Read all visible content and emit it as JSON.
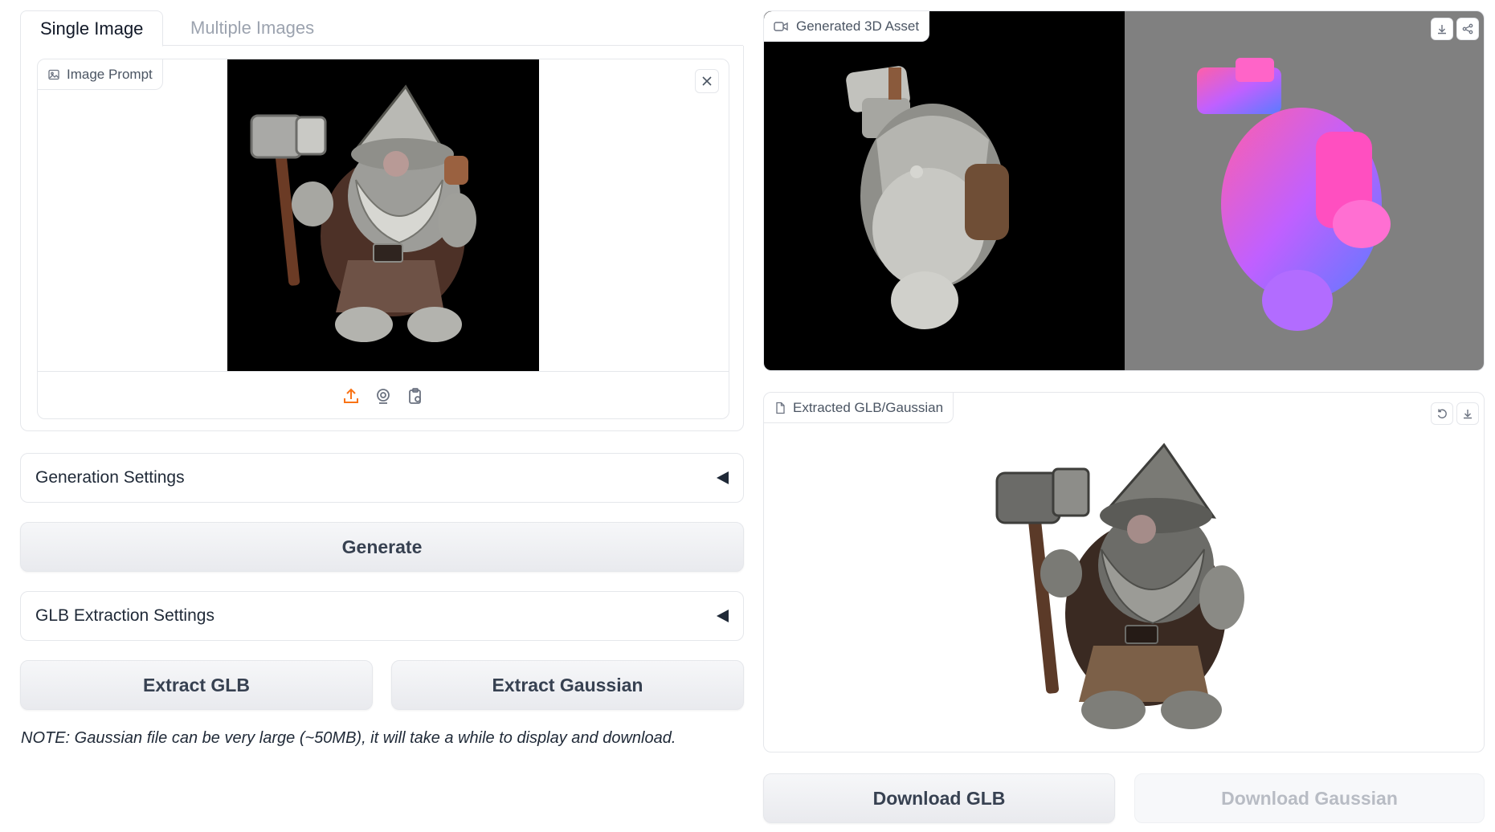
{
  "tabs": [
    {
      "label": "Single Image",
      "active": true
    },
    {
      "label": "Multiple Images",
      "active": false
    }
  ],
  "image_prompt": {
    "label": "Image Prompt",
    "image_description_icon": "image-icon",
    "source_icons": [
      "upload-icon",
      "webcam-icon",
      "clipboard-icon"
    ]
  },
  "generation_settings": {
    "label": "Generation Settings"
  },
  "generate_button": {
    "label": "Generate"
  },
  "glb_settings": {
    "label": "GLB Extraction Settings"
  },
  "extract_glb_button": {
    "label": "Extract GLB"
  },
  "extract_gaussian_button": {
    "label": "Extract Gaussian"
  },
  "note": "NOTE: Gaussian file can be very large (~50MB), it will take a while to display and download.",
  "video": {
    "label": "Generated 3D Asset",
    "icon": "video-icon",
    "actions": [
      "download-icon",
      "share-icon"
    ]
  },
  "model": {
    "label": "Extracted GLB/Gaussian",
    "icon": "file-icon",
    "actions": [
      "undo-icon",
      "download-icon"
    ]
  },
  "download_glb_button": {
    "label": "Download GLB"
  },
  "download_gaussian_button": {
    "label": "Download Gaussian",
    "disabled": true
  },
  "colors": {
    "accent": "#f97316",
    "border": "#e5e7eb",
    "button_text": "#374151",
    "disabled_text": "#b8bcc4"
  }
}
